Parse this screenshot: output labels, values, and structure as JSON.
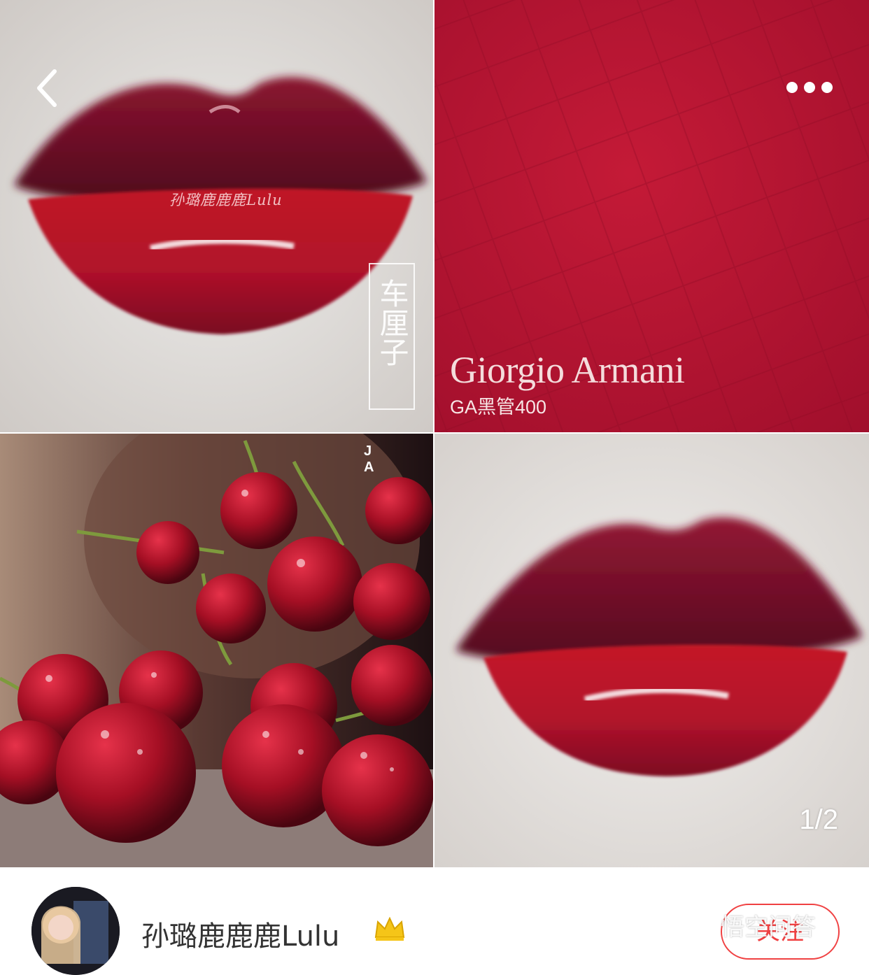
{
  "collage": {
    "watermark_text": "孙璐鹿鹿鹿Lulu",
    "vertical_label": "车厘子",
    "brand_name": "Giorgio Armani",
    "shade_label": "GA黑管400",
    "corner_letters": "J A",
    "pager": "1/2"
  },
  "navigation": {
    "back_icon": "chevron-left-icon",
    "more_icon": "more-dots-icon"
  },
  "author": {
    "name": "孙璐鹿鹿鹿Lulu",
    "badge_icon": "crown-icon",
    "follow_label": "关注"
  },
  "site_watermark": "悟空问答",
  "colors": {
    "lip_red": "#a8112c",
    "swatch_red": "#b31432",
    "cherry_red": "#9c0f22",
    "follow_red": "#f04142"
  }
}
